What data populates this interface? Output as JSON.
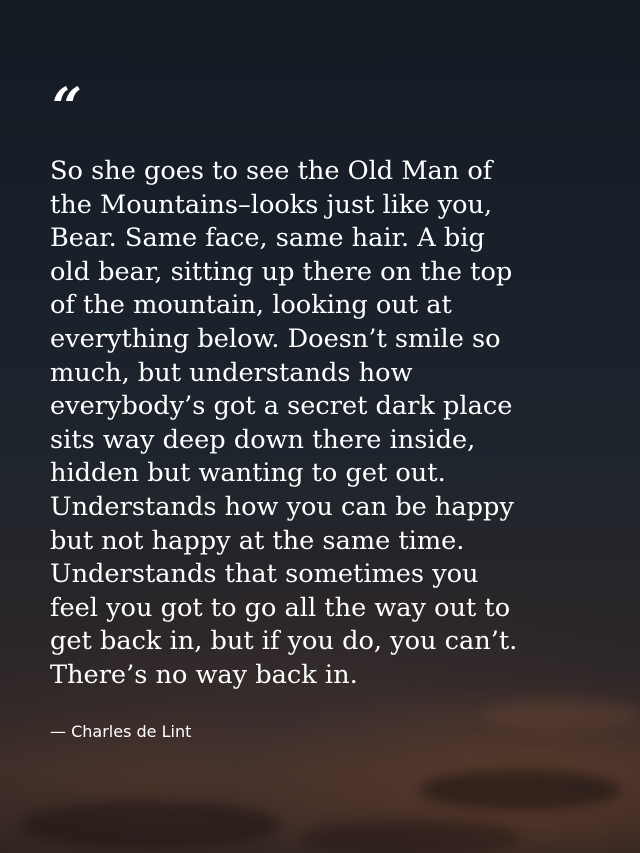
{
  "quote": {
    "mark": "“",
    "text": "So she goes to see the Old Man of\nthe Mountains–looks just like you,\nBear. Same face, same hair. A big\nold bear, sitting up there on the top\nof the mountain, looking out at\neverything below. Doesn’t smile so\nmuch, but understands how\neverybody’s got a secret dark place\nsits way deep down there inside,\nhidden but wanting to get out.\nUnderstands how you can be happy\nbut not happy at the same time.\nUnderstands that sometimes you\nfeel you got to go all the way out to\nget back in, but if you do, you can’t.\nThere’s no way back in.",
    "author": "— Charles de Lint"
  },
  "colors": {
    "text": "#ffffff",
    "background_top": "#141b23",
    "background_bottom": "#3a2c28"
  }
}
